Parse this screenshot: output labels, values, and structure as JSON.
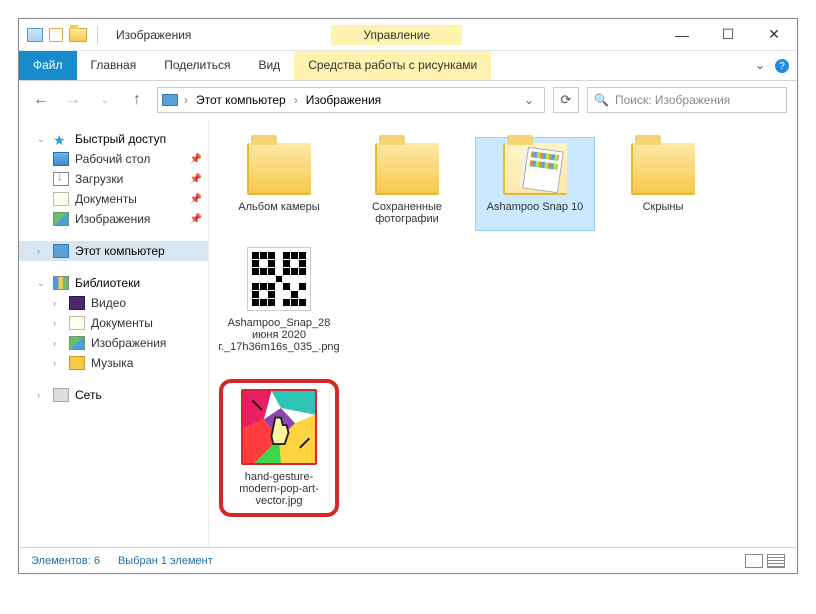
{
  "title": "Изображения",
  "context_tab_top": "Управление",
  "ribbon": {
    "file": "Файл",
    "home": "Главная",
    "share": "Поделиться",
    "view": "Вид",
    "picture_tools": "Средства работы с рисунками"
  },
  "address": {
    "root": "Этот компьютер",
    "folder": "Изображения"
  },
  "search_placeholder": "Поиск: Изображения",
  "sidebar": {
    "quick_access": "Быстрый доступ",
    "desktop": "Рабочий стол",
    "downloads": "Загрузки",
    "documents": "Документы",
    "pictures": "Изображения",
    "this_pc": "Этот компьютер",
    "libraries": "Библиотеки",
    "video": "Видео",
    "documents2": "Документы",
    "pictures2": "Изображения",
    "music": "Музыка",
    "network": "Сеть"
  },
  "items": {
    "camera_roll": "Альбом камеры",
    "saved_pictures": "Сохраненные фотографии",
    "ashampoo": "Ashampoo Snap 10",
    "screenshots": "Скрыны",
    "snap_file": "Ashampoo_Snap_28 июня 2020 г._17h36m16s_035_.png",
    "hand_gesture": "hand-gesture-modern-pop-art-vector.jpg"
  },
  "status": {
    "count": "Элементов: 6",
    "selected": "Выбран 1 элемент"
  }
}
